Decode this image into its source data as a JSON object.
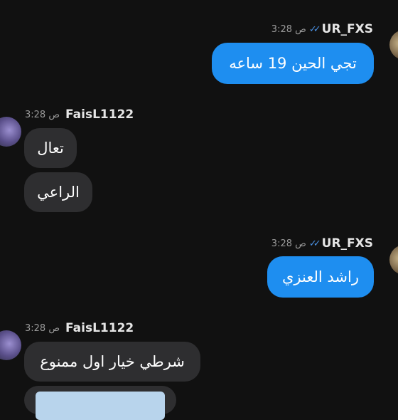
{
  "messages": [
    {
      "direction": "outgoing",
      "author": "UR_FXS",
      "time": "3:28 ص",
      "read": true,
      "bubbles": [
        "تجي الحين 19 ساعه"
      ]
    },
    {
      "direction": "incoming",
      "author": "FaisL1122",
      "time": "3:28 ص",
      "bubbles": [
        "تعال",
        "الراعي"
      ]
    },
    {
      "direction": "outgoing",
      "author": "UR_FXS",
      "time": "3:28 ص",
      "read": true,
      "bubbles": [
        "راشد العنزي"
      ]
    },
    {
      "direction": "incoming",
      "author": "FaisL1122",
      "time": "3:28 ص",
      "bubbles": [
        "شرطي خيار اول ممنوع"
      ]
    }
  ],
  "icons": {
    "read_receipt": "double-check-icon"
  },
  "colors": {
    "outgoing_bubble": "#1e8ef0",
    "incoming_bubble": "#2e2e30",
    "background": "#111111",
    "read_ticks": "#4a90e2"
  }
}
